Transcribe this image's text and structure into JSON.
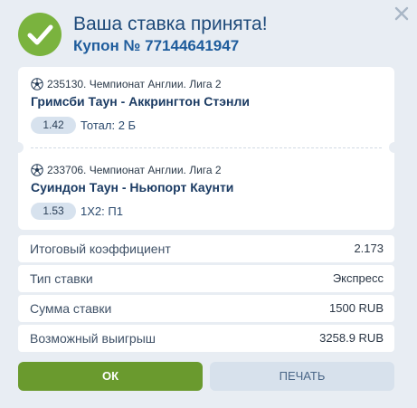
{
  "header": {
    "title": "Ваша ставка принята!",
    "coupon": "Купон № 77144641947",
    "icons": {
      "status": "check-circle-icon",
      "close": "close-icon"
    },
    "colors": {
      "accent_green": "#7ab33e",
      "title_blue": "#1e4a7a"
    }
  },
  "bets": [
    {
      "event": "235130. Чемпионат Англии. Лига 2",
      "teams": "Гримсби Таун - Аккрингтон Стэнли",
      "odds": "1.42",
      "market": "Тотал: 2 Б",
      "icon": "soccer-ball-icon"
    },
    {
      "event": "233706. Чемпионат Англии. Лига 2",
      "teams": "Суиндон Таун - Ньюпорт Каунти",
      "odds": "1.53",
      "market": "1X2: П1",
      "icon": "soccer-ball-icon"
    }
  ],
  "summary": {
    "total_odds": {
      "label": "Итоговый коэффициент",
      "value": "2.173"
    },
    "bet_type": {
      "label": "Тип ставки",
      "value": "Экспресс"
    },
    "stake": {
      "label": "Сумма ставки",
      "value": "1500 RUB"
    },
    "potential_win": {
      "label": "Возможный выигрыш",
      "value": "3258.9 RUB"
    }
  },
  "buttons": {
    "ok": "ОК",
    "print": "ПЕЧАТЬ"
  }
}
